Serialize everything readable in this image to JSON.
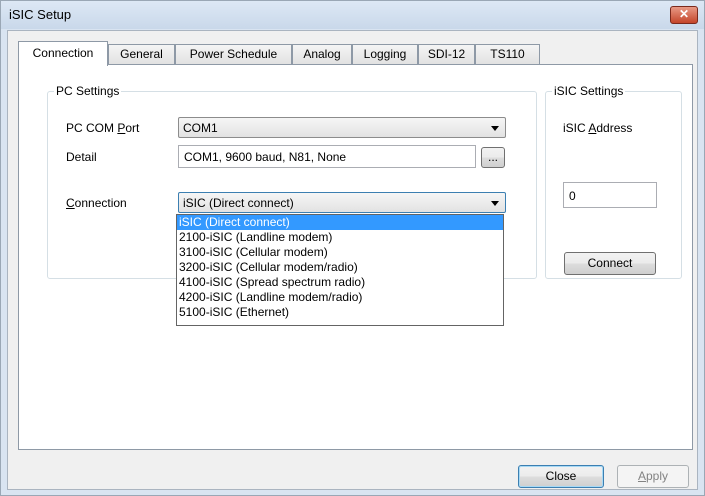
{
  "window": {
    "title": "iSIC Setup",
    "close_glyph": "✕"
  },
  "tabs": [
    {
      "label": "Connection",
      "active": true
    },
    {
      "label": "General"
    },
    {
      "label": "Power Schedule"
    },
    {
      "label": "Analog"
    },
    {
      "label": "Logging"
    },
    {
      "label": "SDI-12"
    },
    {
      "label": "TS110"
    }
  ],
  "pc_settings": {
    "title": "PC Settings",
    "com_port_label_pre": "PC COM ",
    "com_port_label_u": "P",
    "com_port_label_post": "ort",
    "com_port_value": "COM1",
    "detail_label": "Detail",
    "detail_value": "COM1, 9600 baud, N81, None",
    "detail_button": "...",
    "connection_label_u": "C",
    "connection_label_post": "onnection",
    "connection_value": "iSIC (Direct connect)",
    "connection_options": [
      "iSIC (Direct connect)",
      "2100-iSIC (Landline modem)",
      "3100-iSIC (Cellular modem)",
      "3200-iSIC (Cellular modem/radio)",
      "4100-iSIC (Spread spectrum radio)",
      "4200-iSIC (Landline modem/radio)",
      "5100-iSIC (Ethernet)"
    ]
  },
  "isic_settings": {
    "title": "iSIC Settings",
    "address_label_pre": "iSIC ",
    "address_label_u": "A",
    "address_label_post": "ddress",
    "address_value": "0",
    "connect_button": "Connect"
  },
  "footer": {
    "close_button": "Close",
    "apply_button_u": "A",
    "apply_button_post": "pply"
  }
}
